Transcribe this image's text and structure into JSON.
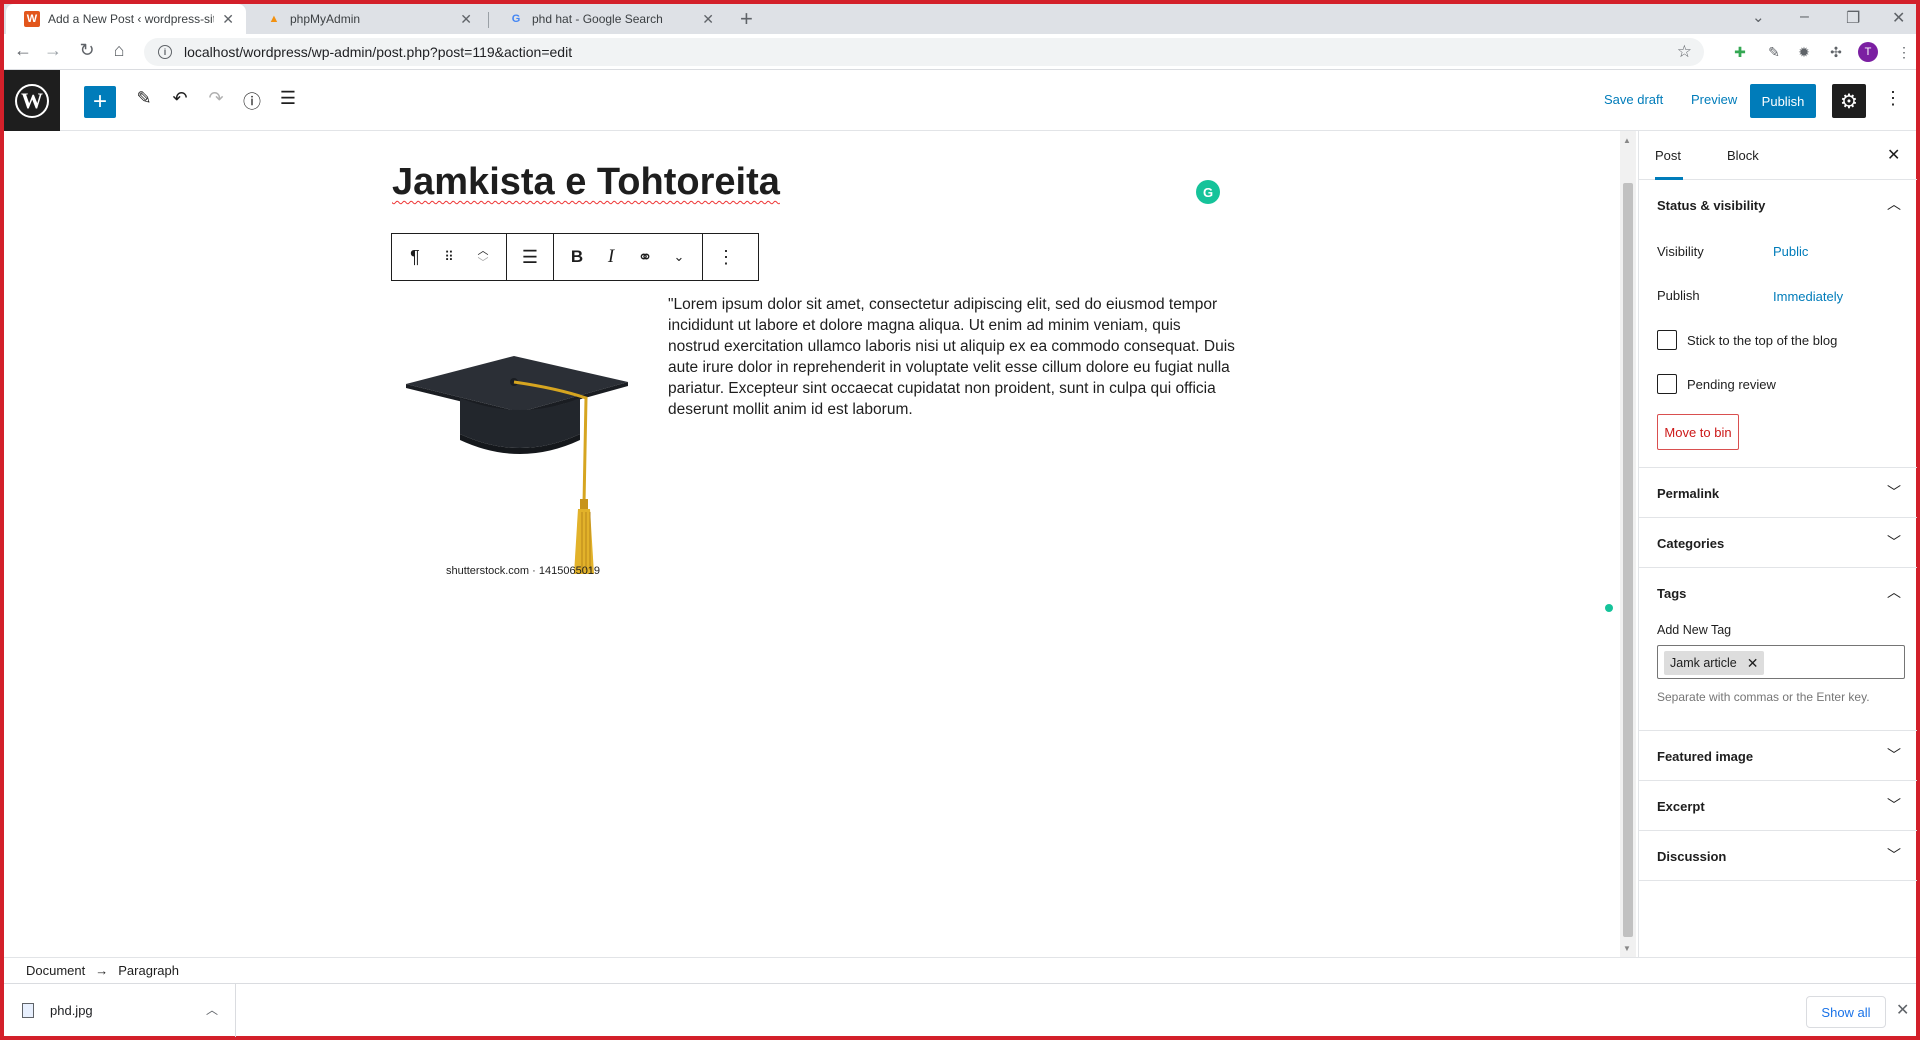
{
  "browser": {
    "tabs": [
      {
        "title": "Add a New Post ‹ wordpress-site",
        "active": true,
        "favicon": "wordpress-tab-icon"
      },
      {
        "title": "phpMyAdmin",
        "active": false,
        "favicon": "phpmyadmin-icon"
      },
      {
        "title": "phd hat - Google Search",
        "active": false,
        "favicon": "google-icon"
      }
    ],
    "url": "localhost/wordpress/wp-admin/post.php?post=119&action=edit",
    "avatar_letter": "T"
  },
  "header": {
    "save_draft": "Save draft",
    "preview": "Preview",
    "publish": "Publish"
  },
  "post": {
    "title": "Jamkista e Tohtoreita",
    "image_caption": "shutterstock.com · 1415065019",
    "paragraph": "\"Lorem ipsum dolor sit amet, consectetur adipiscing elit, sed do eiusmod tempor incididunt ut labore et dolore magna aliqua. Ut enim ad minim veniam, quis nostrud exercitation ullamco laboris nisi ut aliquip ex ea commodo consequat. Duis aute irure dolor in reprehenderit in voluptate velit esse cillum dolore eu fugiat nulla pariatur. Excepteur sint occaecat cupidatat non proident, sunt in culpa qui officia deserunt mollit anim id est laborum."
  },
  "sidebar": {
    "tab_post": "Post",
    "tab_block": "Block",
    "status_title": "Status & visibility",
    "visibility_label": "Visibility",
    "visibility_value": "Public",
    "publish_label": "Publish",
    "publish_value": "Immediately",
    "stick_label": "Stick to the top of the blog",
    "pending_label": "Pending review",
    "move_to_bin": "Move to bin",
    "permalink": "Permalink",
    "categories": "Categories",
    "tags": "Tags",
    "add_new_tag": "Add New Tag",
    "tag_chip": "Jamk article",
    "tag_help": "Separate with commas or the Enter key.",
    "featured_image": "Featured image",
    "excerpt": "Excerpt",
    "discussion": "Discussion"
  },
  "breadcrumb": {
    "document": "Document",
    "arrow": "→",
    "paragraph": "Paragraph"
  },
  "downloads": {
    "file": "phd.jpg",
    "show_all": "Show all"
  },
  "colors": {
    "wp_blue": "#007cba",
    "frame_red": "#d3202a",
    "grammarly_green": "#15c39a"
  }
}
